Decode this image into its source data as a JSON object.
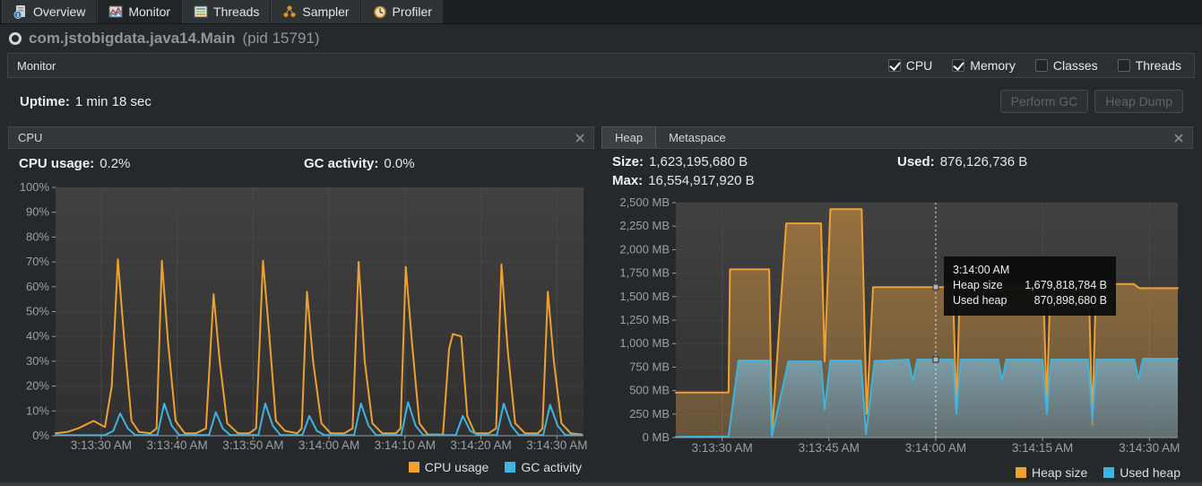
{
  "tabs": [
    {
      "label": "Overview",
      "icon": "overview-document-icon",
      "selected": false
    },
    {
      "label": "Monitor",
      "icon": "monitor-chart-icon",
      "selected": true
    },
    {
      "label": "Threads",
      "icon": "threads-list-icon",
      "selected": false
    },
    {
      "label": "Sampler",
      "icon": "sampler-icon",
      "selected": false
    },
    {
      "label": "Profiler",
      "icon": "profiler-clock-icon",
      "selected": false
    }
  ],
  "app": {
    "title": "com.jstobigdata.java14.Main",
    "pid": "(pid 15791)",
    "status_icon": "running-ring-icon"
  },
  "toolbar": {
    "title": "Monitor",
    "checkboxes": [
      {
        "label": "CPU",
        "checked": true
      },
      {
        "label": "Memory",
        "checked": true
      },
      {
        "label": "Classes",
        "checked": false
      },
      {
        "label": "Threads",
        "checked": false
      }
    ]
  },
  "status": {
    "uptime_label": "Uptime:",
    "uptime_value": "1 min 18 sec",
    "buttons": [
      {
        "label": "Perform GC"
      },
      {
        "label": "Heap Dump"
      }
    ]
  },
  "cpu_panel": {
    "title": "CPU",
    "close_icon": "close-x-icon",
    "stats": [
      {
        "label": "CPU usage:",
        "value": "0.2%"
      },
      {
        "label": "GC activity:",
        "value": "0.0%"
      }
    ]
  },
  "heap_panel": {
    "tabs": [
      {
        "label": "Heap",
        "selected": true
      },
      {
        "label": "Metaspace",
        "selected": false
      }
    ],
    "close_icon": "close-x-icon",
    "stats": [
      {
        "label": "Size:",
        "value": "1,623,195,680 B"
      },
      {
        "label": "Used:",
        "value": "876,126,736 B"
      },
      {
        "label": "Max:",
        "value": "16,554,917,920 B"
      }
    ]
  },
  "colors": {
    "orange": "#EFA02F",
    "blue": "#3FB2DF",
    "plot_bg_top": "#414141",
    "plot_bg_bottom": "#303030",
    "axis_text": "#9aa0a2"
  },
  "chart_data": [
    {
      "id": "cpu-activity",
      "type": "line",
      "title": "CPU",
      "x_unit": "seconds after 3:13:00 AM",
      "xlim": [
        24,
        93.5
      ],
      "ylim": [
        0,
        100
      ],
      "grid": true,
      "legend_position": "bottom-right",
      "xticks": [
        {
          "v": 30,
          "label": "3:13:30 AM"
        },
        {
          "v": 40,
          "label": "3:13:40 AM"
        },
        {
          "v": 50,
          "label": "3:13:50 AM"
        },
        {
          "v": 60,
          "label": "3:14:00 AM"
        },
        {
          "v": 70,
          "label": "3:14:10 AM"
        },
        {
          "v": 80,
          "label": "3:14:20 AM"
        },
        {
          "v": 90,
          "label": "3:14:30 AM"
        }
      ],
      "yticks": [
        {
          "v": 0,
          "label": "0%"
        },
        {
          "v": 10,
          "label": "10%"
        },
        {
          "v": 20,
          "label": "20%"
        },
        {
          "v": 30,
          "label": "30%"
        },
        {
          "v": 40,
          "label": "40%"
        },
        {
          "v": 50,
          "label": "50%"
        },
        {
          "v": 60,
          "label": "60%"
        },
        {
          "v": 70,
          "label": "70%"
        },
        {
          "v": 80,
          "label": "80%"
        },
        {
          "v": 90,
          "label": "90%"
        },
        {
          "v": 100,
          "label": "100%"
        }
      ],
      "series": [
        {
          "name": "CPU usage",
          "color": "#EFA02F",
          "points": [
            [
              24,
              1
            ],
            [
              25.5,
              1.5
            ],
            [
              27,
              3
            ],
            [
              29,
              6
            ],
            [
              30.5,
              3.5
            ],
            [
              31.4,
              20
            ],
            [
              32.2,
              71
            ],
            [
              33,
              40
            ],
            [
              34,
              6
            ],
            [
              35,
              1.5
            ],
            [
              36.5,
              1
            ],
            [
              37.3,
              3
            ],
            [
              38,
              70.5
            ],
            [
              38.8,
              38
            ],
            [
              39.8,
              6
            ],
            [
              41,
              1
            ],
            [
              42.5,
              1
            ],
            [
              43.8,
              3
            ],
            [
              44.8,
              57
            ],
            [
              45.6,
              30
            ],
            [
              46.6,
              5
            ],
            [
              48,
              1
            ],
            [
              49.5,
              1
            ],
            [
              50.4,
              3
            ],
            [
              51.3,
              70.5
            ],
            [
              52.1,
              42
            ],
            [
              53,
              6
            ],
            [
              54.2,
              2
            ],
            [
              55.8,
              1
            ],
            [
              56.4,
              3
            ],
            [
              57.1,
              58
            ],
            [
              57.9,
              30
            ],
            [
              59,
              5
            ],
            [
              60.2,
              1
            ],
            [
              62,
              1
            ],
            [
              63.1,
              3
            ],
            [
              63.9,
              70
            ],
            [
              64.7,
              30
            ],
            [
              65.7,
              5
            ],
            [
              67,
              1
            ],
            [
              68.8,
              1
            ],
            [
              69.4,
              3
            ],
            [
              70.1,
              68
            ],
            [
              70.9,
              38
            ],
            [
              71.9,
              5
            ],
            [
              73,
              0.5
            ],
            [
              75,
              0.5
            ],
            [
              75.8,
              35
            ],
            [
              76.3,
              41
            ],
            [
              77.4,
              40
            ],
            [
              78.2,
              8
            ],
            [
              79.2,
              1
            ],
            [
              81,
              1
            ],
            [
              82,
              3
            ],
            [
              82.7,
              69
            ],
            [
              83.5,
              35
            ],
            [
              84.5,
              5
            ],
            [
              85.8,
              1
            ],
            [
              87.5,
              1
            ],
            [
              88.1,
              3
            ],
            [
              88.8,
              58
            ],
            [
              89.6,
              30
            ],
            [
              90.6,
              5
            ],
            [
              91.8,
              1
            ],
            [
              93.3,
              0.5
            ]
          ]
        },
        {
          "name": "GC activity",
          "color": "#3FB2DF",
          "points": [
            [
              24,
              0.2
            ],
            [
              30.5,
              0.3
            ],
            [
              31.6,
              2
            ],
            [
              32.5,
              9
            ],
            [
              33.5,
              3
            ],
            [
              34.5,
              0.3
            ],
            [
              37.4,
              0.3
            ],
            [
              38.3,
              13
            ],
            [
              39.3,
              4
            ],
            [
              40.3,
              0.3
            ],
            [
              44.2,
              0.3
            ],
            [
              45.1,
              9.5
            ],
            [
              46,
              3
            ],
            [
              47,
              0.3
            ],
            [
              50.7,
              0.3
            ],
            [
              51.6,
              13
            ],
            [
              52.6,
              4
            ],
            [
              53.6,
              0.3
            ],
            [
              56.5,
              0.3
            ],
            [
              57.4,
              8
            ],
            [
              58.4,
              2
            ],
            [
              59.4,
              0.3
            ],
            [
              63.3,
              0.3
            ],
            [
              64.2,
              13
            ],
            [
              65.2,
              4
            ],
            [
              66.2,
              0.3
            ],
            [
              69.5,
              0.3
            ],
            [
              70.4,
              13.5
            ],
            [
              71.4,
              4
            ],
            [
              72.4,
              0.3
            ],
            [
              76.7,
              0.3
            ],
            [
              77.6,
              8
            ],
            [
              78.6,
              2
            ],
            [
              79.6,
              0.3
            ],
            [
              82.1,
              0.3
            ],
            [
              83,
              13
            ],
            [
              84,
              4
            ],
            [
              85,
              0.3
            ],
            [
              88.2,
              0.3
            ],
            [
              89.1,
              12.5
            ],
            [
              90.1,
              4
            ],
            [
              91.1,
              0.3
            ],
            [
              93.3,
              0.2
            ]
          ]
        }
      ]
    },
    {
      "id": "heap-memory",
      "type": "area",
      "title": "Heap",
      "x_unit": "seconds after 3:13:00 AM",
      "y_unit": "MB",
      "xlim": [
        23.5,
        94
      ],
      "ylim": [
        0,
        2500
      ],
      "grid": true,
      "legend_position": "bottom-right",
      "xticks": [
        {
          "v": 30,
          "label": "3:13:30 AM"
        },
        {
          "v": 45,
          "label": "3:13:45 AM"
        },
        {
          "v": 60,
          "label": "3:14:00 AM"
        },
        {
          "v": 75,
          "label": "3:14:15 AM"
        },
        {
          "v": 90,
          "label": "3:14:30 AM"
        }
      ],
      "yticks": [
        {
          "v": 0,
          "label": "0 MB"
        },
        {
          "v": 250,
          "label": "250 MB"
        },
        {
          "v": 500,
          "label": "500 MB"
        },
        {
          "v": 750,
          "label": "750 MB"
        },
        {
          "v": 1000,
          "label": "1,000 MB"
        },
        {
          "v": 1250,
          "label": "1,250 MB"
        },
        {
          "v": 1500,
          "label": "1,500 MB"
        },
        {
          "v": 1750,
          "label": "1,750 MB"
        },
        {
          "v": 2000,
          "label": "2,000 MB"
        },
        {
          "v": 2250,
          "label": "2,250 MB"
        },
        {
          "v": 2500,
          "label": "2,500 MB"
        }
      ],
      "series": [
        {
          "name": "Heap size",
          "color": "#EFA02F",
          "fill_top": "rgba(222,152,60,0.55)",
          "fill_bottom": "rgba(205,150,75,0.35)",
          "points": [
            [
              23.5,
              480
            ],
            [
              30.9,
              480
            ],
            [
              31.1,
              1790
            ],
            [
              36.6,
              1790
            ],
            [
              37,
              25
            ],
            [
              39,
              2280
            ],
            [
              43.9,
              2280
            ],
            [
              44.4,
              810
            ],
            [
              45.2,
              2430
            ],
            [
              49.6,
              2430
            ],
            [
              50.3,
              250
            ],
            [
              51.2,
              1600
            ],
            [
              62.4,
              1600
            ],
            [
              62.9,
              290
            ],
            [
              63.4,
              1600
            ],
            [
              75.1,
              1600
            ],
            [
              75.6,
              350
            ],
            [
              76.1,
              1600
            ],
            [
              81.5,
              1600
            ],
            [
              82,
              130
            ],
            [
              82.5,
              1635
            ],
            [
              87.8,
              1635
            ],
            [
              88.6,
              1590
            ],
            [
              94,
              1590
            ]
          ]
        },
        {
          "name": "Used heap",
          "color": "#3FB2DF",
          "fill_top": "rgba(125,168,188,0.85)",
          "fill_bottom": "rgba(95,128,148,0.6)",
          "points": [
            [
              23.5,
              8
            ],
            [
              30.9,
              12
            ],
            [
              32.3,
              820
            ],
            [
              36.6,
              820
            ],
            [
              37,
              15
            ],
            [
              39.3,
              810
            ],
            [
              43.9,
              810
            ],
            [
              44.4,
              300
            ],
            [
              45.2,
              820
            ],
            [
              49.5,
              820
            ],
            [
              50.2,
              35
            ],
            [
              51.4,
              815
            ],
            [
              56.2,
              830
            ],
            [
              56.8,
              600
            ],
            [
              57.4,
              830
            ],
            [
              62.4,
              830
            ],
            [
              62.9,
              250
            ],
            [
              63.5,
              830
            ],
            [
              68.8,
              830
            ],
            [
              69.3,
              610
            ],
            [
              69.9,
              830
            ],
            [
              75,
              830
            ],
            [
              75.6,
              250
            ],
            [
              76.2,
              830
            ],
            [
              81.4,
              830
            ],
            [
              82,
              185
            ],
            [
              82.6,
              830
            ],
            [
              87.9,
              830
            ],
            [
              88.5,
              620
            ],
            [
              89.1,
              840
            ],
            [
              94,
              840
            ]
          ]
        }
      ],
      "annotation": {
        "x": 60,
        "markers": [
          [
            60,
            1602
          ],
          [
            60,
            830
          ]
        ]
      },
      "tooltip": {
        "time": "3:14:00 AM",
        "rows": [
          {
            "label": "Heap size",
            "value": "1,679,818,784 B"
          },
          {
            "label": "Used heap",
            "value": "870,898,680 B"
          }
        ]
      }
    }
  ]
}
